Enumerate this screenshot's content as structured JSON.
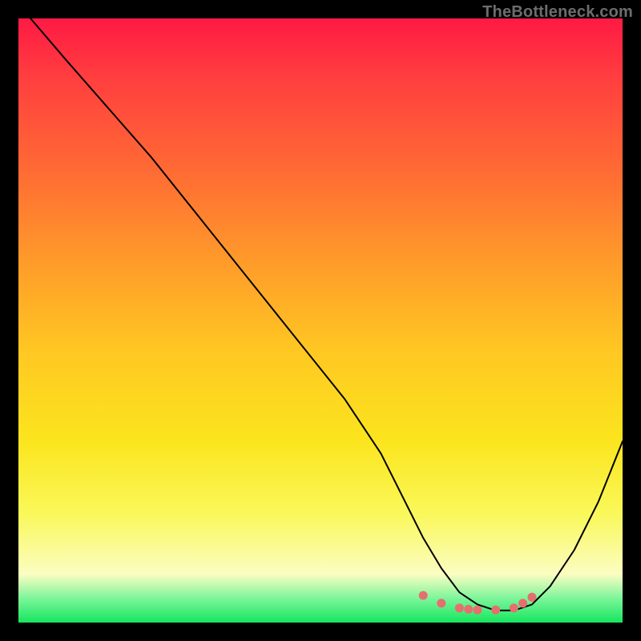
{
  "watermark": "TheBottleneck.com",
  "colors": {
    "frame": "#000000",
    "gradient_top": "#ff1a44",
    "gradient_bottom": "#15e65e",
    "curve": "#000000",
    "dots": "#e76e6e"
  },
  "chart_data": {
    "type": "line",
    "title": "",
    "xlabel": "",
    "ylabel": "",
    "xlim": [
      0,
      100
    ],
    "ylim": [
      0,
      100
    ],
    "series": [
      {
        "name": "bottleneck-curve",
        "x": [
          2,
          8,
          15,
          22,
          30,
          38,
          46,
          54,
          60,
          64,
          67,
          70,
          73,
          76,
          79,
          82,
          85,
          88,
          92,
          96,
          100
        ],
        "y": [
          100,
          93,
          85,
          77,
          67,
          57,
          47,
          37,
          28,
          20,
          14,
          9,
          5,
          3,
          2,
          2,
          3,
          6,
          12,
          20,
          30
        ]
      }
    ],
    "markers": {
      "name": "highlight-dots",
      "x": [
        67,
        70,
        73,
        74.5,
        76,
        79,
        82,
        83.5,
        85
      ],
      "y": [
        4.5,
        3.2,
        2.4,
        2.2,
        2.1,
        2.1,
        2.4,
        3.2,
        4.2
      ]
    }
  }
}
